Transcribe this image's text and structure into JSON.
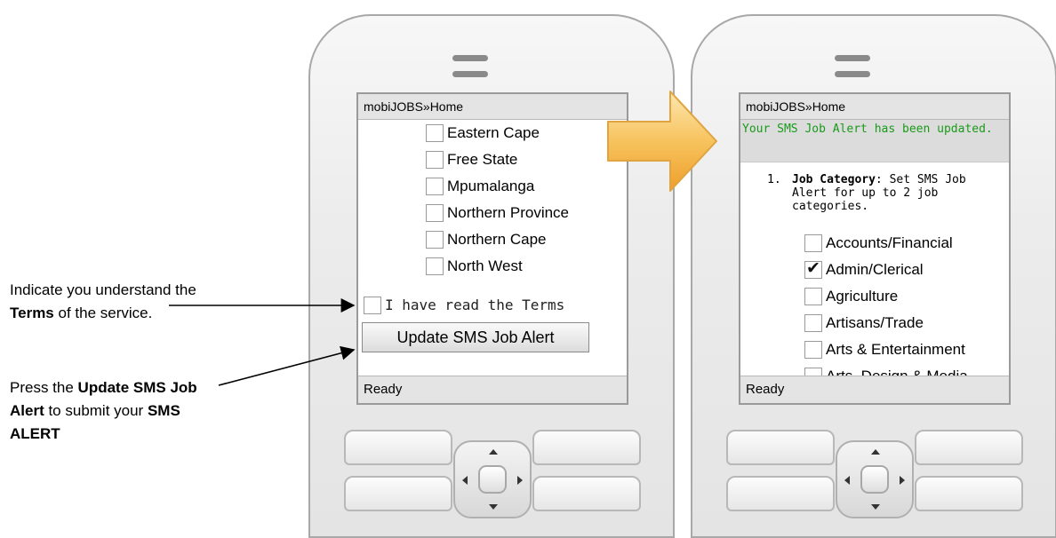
{
  "annotations": {
    "terms_note": {
      "before": "Indicate you understand the ",
      "bold": "Terms",
      "after": " of the service."
    },
    "submit_note": {
      "before": "Press the ",
      "bold1": "Update SMS Job Alert",
      "middle": " to submit your ",
      "bold2": "SMS ALERT"
    }
  },
  "phone_left": {
    "title": "mobiJOBS»Home",
    "provinces": [
      {
        "label": "Eastern Cape",
        "checked": false
      },
      {
        "label": "Free State",
        "checked": false
      },
      {
        "label": "Mpumalanga",
        "checked": false
      },
      {
        "label": "Northern Province",
        "checked": false
      },
      {
        "label": "Northern Cape",
        "checked": false
      },
      {
        "label": "North West",
        "checked": false
      }
    ],
    "terms_label": "I have read the Terms",
    "terms_checked": false,
    "update_button": "Update SMS Job Alert",
    "status": "Ready"
  },
  "phone_right": {
    "title": "mobiJOBS»Home",
    "success_message": "Your SMS Job Alert has been updated.",
    "job_category": {
      "number": "1.",
      "heading": "Job Category",
      "text": ": Set SMS Job Alert for up to 2 job categories."
    },
    "categories": [
      {
        "label": "Accounts/Financial",
        "checked": false
      },
      {
        "label": "Admin/Clerical",
        "checked": true
      },
      {
        "label": "Agriculture",
        "checked": false
      },
      {
        "label": "Artisans/Trade",
        "checked": false
      },
      {
        "label": "Arts & Entertainment",
        "checked": false
      },
      {
        "label": "Arts, Design & Media",
        "checked": false
      }
    ],
    "status": "Ready"
  },
  "colors": {
    "success_text": "#1a9a1a",
    "arrow_fill": "#f5b84a",
    "bar_gray": "#e4e4e4"
  },
  "icons": [
    "dpad-up-icon",
    "dpad-down-icon",
    "dpad-left-icon",
    "dpad-right-icon",
    "flow-arrow-icon",
    "checkmark-icon"
  ]
}
